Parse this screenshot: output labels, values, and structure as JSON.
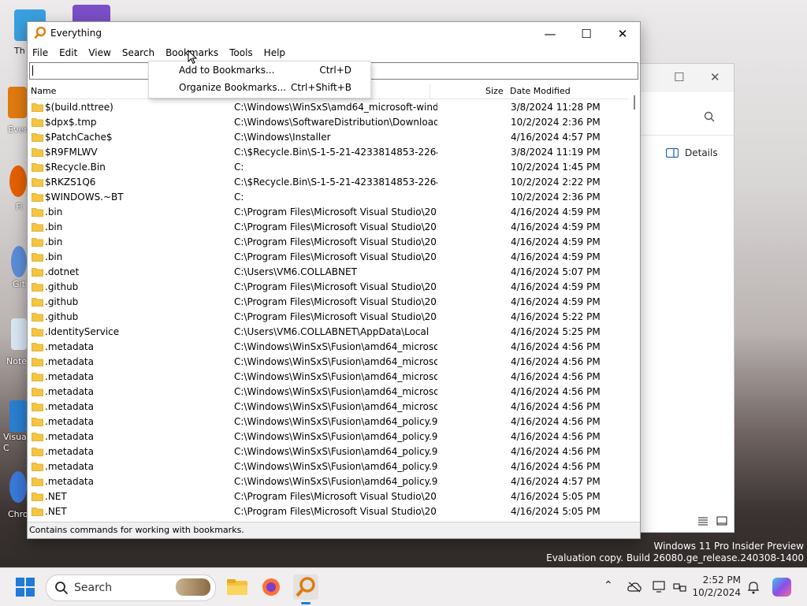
{
  "window": {
    "title": "Everything",
    "controls": {
      "minimize": "—",
      "maximize": "☐",
      "close": "✕"
    }
  },
  "menu": [
    "File",
    "Edit",
    "View",
    "Search",
    "Bookmarks",
    "Tools",
    "Help"
  ],
  "active_menu": "Bookmarks",
  "dropdown": {
    "items": [
      {
        "label": "Add to Bookmarks...",
        "shortcut": "Ctrl+D"
      },
      {
        "label": "Organize Bookmarks...",
        "shortcut": "Ctrl+Shift+B"
      }
    ]
  },
  "search": {
    "value": ""
  },
  "columns": {
    "name": "Name",
    "size": "Size",
    "date": "Date Modified"
  },
  "rows": [
    {
      "name": "$(build.nttree)",
      "path": "C:\\Windows\\WinSxS\\amd64_microsoft-wind...",
      "date": "3/8/2024 11:28 PM"
    },
    {
      "name": "$dpx$.tmp",
      "path": "C:\\Windows\\SoftwareDistribution\\Download...",
      "date": "10/2/2024 2:36 PM"
    },
    {
      "name": "$PatchCache$",
      "path": "C:\\Windows\\Installer",
      "date": "4/16/2024 4:57 PM"
    },
    {
      "name": "$R9FMLWV",
      "path": "C:\\$Recycle.Bin\\S-1-5-21-4233814853-226430...",
      "date": "3/8/2024 11:19 PM"
    },
    {
      "name": "$Recycle.Bin",
      "path": "C:",
      "date": "10/2/2024 1:45 PM"
    },
    {
      "name": "$RKZS1Q6",
      "path": "C:\\$Recycle.Bin\\S-1-5-21-4233814853-226430...",
      "date": "10/2/2024 2:22 PM"
    },
    {
      "name": "$WINDOWS.~BT",
      "path": "C:",
      "date": "10/2/2024 2:36 PM"
    },
    {
      "name": ".bin",
      "path": "C:\\Program Files\\Microsoft Visual Studio\\202...",
      "date": "4/16/2024 4:59 PM"
    },
    {
      "name": ".bin",
      "path": "C:\\Program Files\\Microsoft Visual Studio\\202...",
      "date": "4/16/2024 4:59 PM"
    },
    {
      "name": ".bin",
      "path": "C:\\Program Files\\Microsoft Visual Studio\\202...",
      "date": "4/16/2024 4:59 PM"
    },
    {
      "name": ".bin",
      "path": "C:\\Program Files\\Microsoft Visual Studio\\202...",
      "date": "4/16/2024 4:59 PM"
    },
    {
      "name": ".dotnet",
      "path": "C:\\Users\\VM6.COLLABNET",
      "date": "4/16/2024 5:07 PM"
    },
    {
      "name": ".github",
      "path": "C:\\Program Files\\Microsoft Visual Studio\\202...",
      "date": "4/16/2024 4:59 PM"
    },
    {
      "name": ".github",
      "path": "C:\\Program Files\\Microsoft Visual Studio\\202...",
      "date": "4/16/2024 4:59 PM"
    },
    {
      "name": ".github",
      "path": "C:\\Program Files\\Microsoft Visual Studio\\202...",
      "date": "4/16/2024 5:22 PM"
    },
    {
      "name": ".IdentityService",
      "path": "C:\\Users\\VM6.COLLABNET\\AppData\\Local",
      "date": "4/16/2024 5:25 PM"
    },
    {
      "name": ".metadata",
      "path": "C:\\Windows\\WinSxS\\Fusion\\amd64_microso...",
      "date": "4/16/2024 4:56 PM"
    },
    {
      "name": ".metadata",
      "path": "C:\\Windows\\WinSxS\\Fusion\\amd64_microso...",
      "date": "4/16/2024 4:56 PM"
    },
    {
      "name": ".metadata",
      "path": "C:\\Windows\\WinSxS\\Fusion\\amd64_microso...",
      "date": "4/16/2024 4:56 PM"
    },
    {
      "name": ".metadata",
      "path": "C:\\Windows\\WinSxS\\Fusion\\amd64_microso...",
      "date": "4/16/2024 4:56 PM"
    },
    {
      "name": ".metadata",
      "path": "C:\\Windows\\WinSxS\\Fusion\\amd64_microso...",
      "date": "4/16/2024 4:56 PM"
    },
    {
      "name": ".metadata",
      "path": "C:\\Windows\\WinSxS\\Fusion\\amd64_policy.9....",
      "date": "4/16/2024 4:56 PM"
    },
    {
      "name": ".metadata",
      "path": "C:\\Windows\\WinSxS\\Fusion\\amd64_policy.9....",
      "date": "4/16/2024 4:56 PM"
    },
    {
      "name": ".metadata",
      "path": "C:\\Windows\\WinSxS\\Fusion\\amd64_policy.9....",
      "date": "4/16/2024 4:56 PM"
    },
    {
      "name": ".metadata",
      "path": "C:\\Windows\\WinSxS\\Fusion\\amd64_policy.9....",
      "date": "4/16/2024 4:56 PM"
    },
    {
      "name": ".metadata",
      "path": "C:\\Windows\\WinSxS\\Fusion\\amd64_policy.9....",
      "date": "4/16/2024 4:57 PM"
    },
    {
      "name": ".NET",
      "path": "C:\\Program Files\\Microsoft Visual Studio\\202...",
      "date": "4/16/2024 5:05 PM"
    },
    {
      "name": ".NET",
      "path": "C:\\Program Files\\Microsoft Visual Studio\\202...",
      "date": "4/16/2024 5:05 PM"
    }
  ],
  "status": "Contains commands for working with bookmarks.",
  "bg_window": {
    "details_label": "Details"
  },
  "desktop_labels": [
    "Th",
    "Ever",
    "Fi",
    "Git",
    "Note",
    "Visua\nC",
    "Chro"
  ],
  "watermark": {
    "line1": "Windows 11 Pro Insider Preview",
    "line2": "Evaluation copy. Build 26080.ge_release.240308-1400"
  },
  "taskbar": {
    "search_label": "Search",
    "time": "2:52 PM",
    "date": "10/2/2024"
  },
  "colors": {
    "folder": "#f4c542",
    "accent": "#e07b10"
  }
}
